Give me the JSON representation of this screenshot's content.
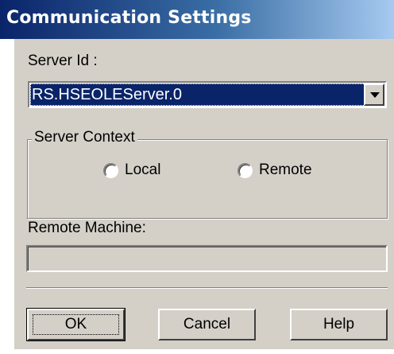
{
  "window": {
    "title": "Communication Settings"
  },
  "server_id": {
    "label": "Server Id :",
    "selected": "RS.HSEOLEServer.0"
  },
  "server_context": {
    "legend": "Server Context",
    "options": [
      {
        "label": "Local"
      },
      {
        "label": "Remote"
      }
    ]
  },
  "remote_machine": {
    "label": "Remote Machine:",
    "value": ""
  },
  "buttons": {
    "ok": "OK",
    "cancel": "Cancel",
    "help": "Help"
  },
  "icons": {
    "dropdown": "chevron-down-icon"
  }
}
